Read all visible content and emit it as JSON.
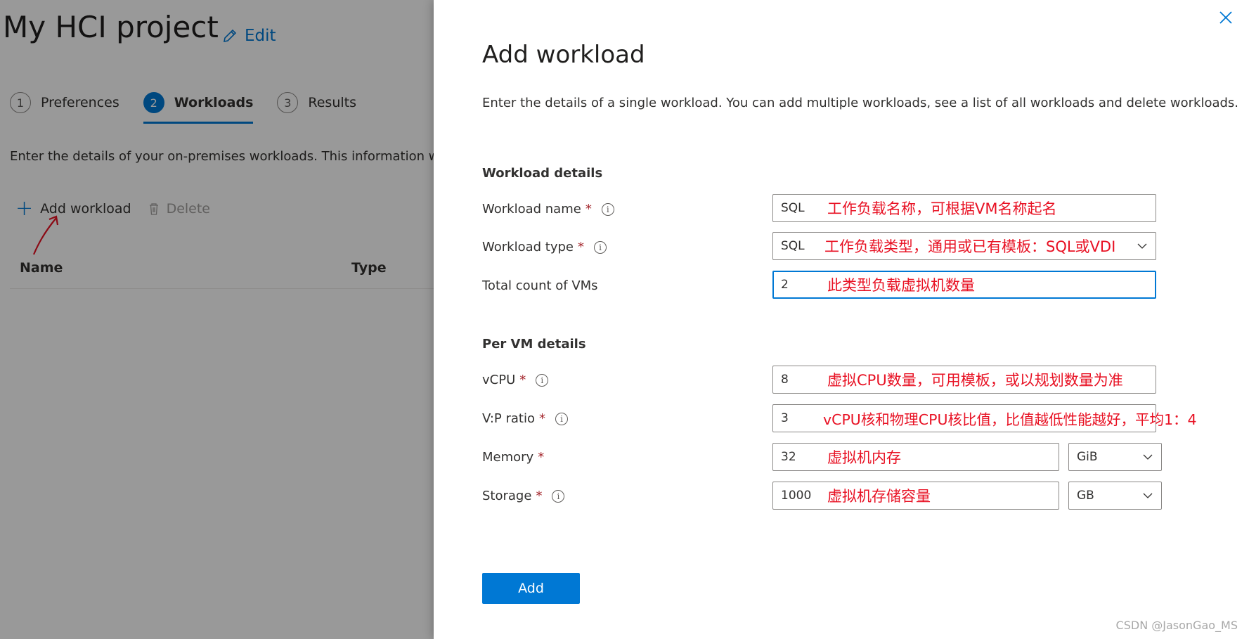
{
  "page": {
    "title": "My HCI project",
    "edit_label": "Edit",
    "steps": [
      {
        "num": "1",
        "label": "Preferences"
      },
      {
        "num": "2",
        "label": "Workloads"
      },
      {
        "num": "3",
        "label": "Results"
      }
    ],
    "description": "Enter the details of your on-premises workloads. This information will b",
    "toolbar": {
      "add_label": "Add workload",
      "delete_label": "Delete"
    },
    "columns": {
      "name": "Name",
      "type": "Type"
    }
  },
  "panel": {
    "title": "Add workload",
    "description": "Enter the details of a single workload. You can add multiple workloads, see a list of all workloads and delete workloads.",
    "workload_section": "Workload details",
    "per_vm_section": "Per VM details",
    "required_mark": "*",
    "info_glyph": "i",
    "fields": {
      "workload_name": {
        "label": "Workload name",
        "value": "SQL",
        "annotation": "工作负载名称，可根据VM名称起名"
      },
      "workload_type": {
        "label": "Workload type",
        "value": "SQL",
        "annotation": "工作负载类型，通用或已有模板：SQL或VDI"
      },
      "total_vms": {
        "label": "Total count of VMs",
        "value": "2",
        "annotation": "此类型负载虚拟机数量"
      },
      "vcpu": {
        "label": "vCPU",
        "value": "8",
        "annotation": "虚拟CPU数量，可用模板，或以规划数量为准"
      },
      "vp_ratio": {
        "label": "V:P ratio",
        "value": "3",
        "annotation": "vCPU核和物理CPU核比值，比值越低性能越好，平均1：4"
      },
      "memory": {
        "label": "Memory",
        "value": "32",
        "unit": "GiB",
        "annotation": "虚拟机内存"
      },
      "storage": {
        "label": "Storage",
        "value": "1000",
        "unit": "GB",
        "annotation": "虚拟机存储容量"
      }
    },
    "add_button": "Add"
  },
  "watermark": "CSDN @JasonGao_MS",
  "colors": {
    "accent": "#0078d4",
    "annotation": "#e81123",
    "required": "#a4262c"
  }
}
